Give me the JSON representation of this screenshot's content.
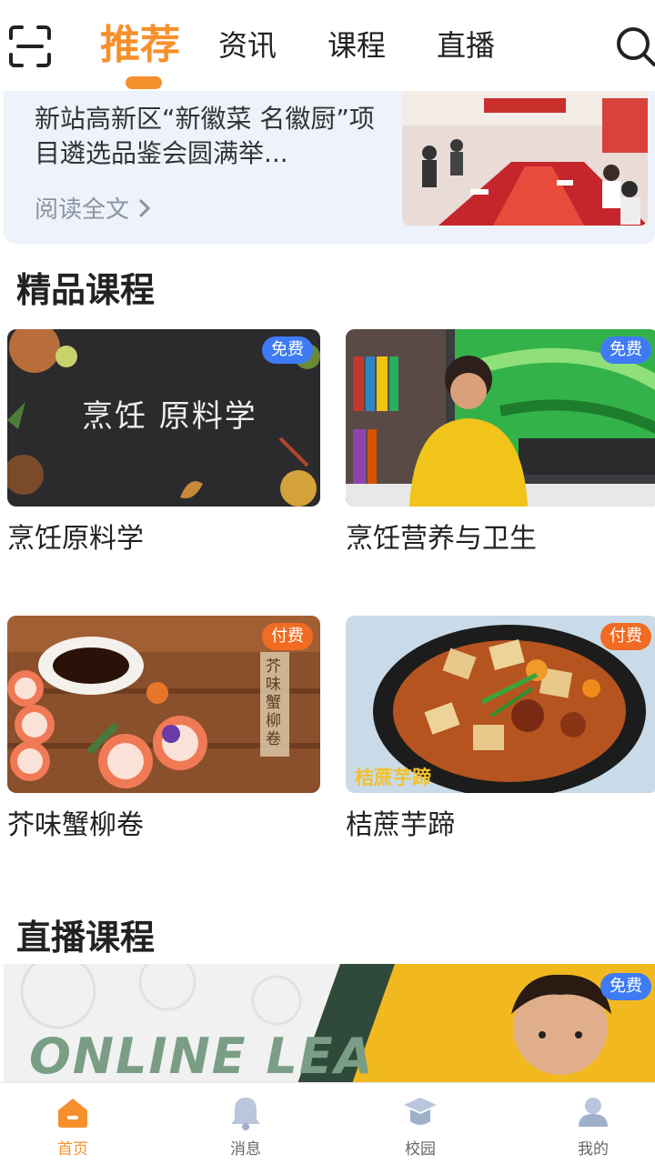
{
  "header": {
    "tabs": [
      {
        "label": "推荐",
        "active": true
      },
      {
        "label": "资讯",
        "active": false
      },
      {
        "label": "课程",
        "active": false
      },
      {
        "label": "直播",
        "active": false
      }
    ],
    "icons": {
      "scan": "scan-icon",
      "search": "search-icon"
    },
    "accent_color": "#f5902d"
  },
  "news": {
    "title": "新站高新区“新徽菜 名徽厨”项目遴选品鉴会圆满举...",
    "read_more": "阅读全文"
  },
  "sections": {
    "featured_title": "精品课程",
    "live_title": "直播课程"
  },
  "courses": [
    {
      "name": "烹饪原料学",
      "badge": "免费",
      "badge_type": "free",
      "image_text": "烹饪 原料学"
    },
    {
      "name": "烹饪营养与卫生",
      "badge": "免费",
      "badge_type": "free",
      "image_text": ""
    },
    {
      "name": "芥味蟹柳卷",
      "badge": "付费",
      "badge_type": "paid",
      "image_text": "芥味蟹柳卷"
    },
    {
      "name": "桔蔗芋蹄",
      "badge": "付费",
      "badge_type": "paid",
      "image_text": "桔蔗芋蹄"
    }
  ],
  "live": {
    "banner_text": "ONLINE LEA",
    "badge": "免费"
  },
  "bottom_nav": [
    {
      "label": "首页",
      "icon": "home-icon",
      "active": true
    },
    {
      "label": "消息",
      "icon": "bell-icon",
      "active": false
    },
    {
      "label": "校园",
      "icon": "graduation-cap-icon",
      "active": false
    },
    {
      "label": "我的",
      "icon": "user-icon",
      "active": false
    }
  ],
  "colors": {
    "badge_free": "#3f7bf5",
    "badge_paid": "#f26b22",
    "news_bg": "#edf2fb"
  }
}
